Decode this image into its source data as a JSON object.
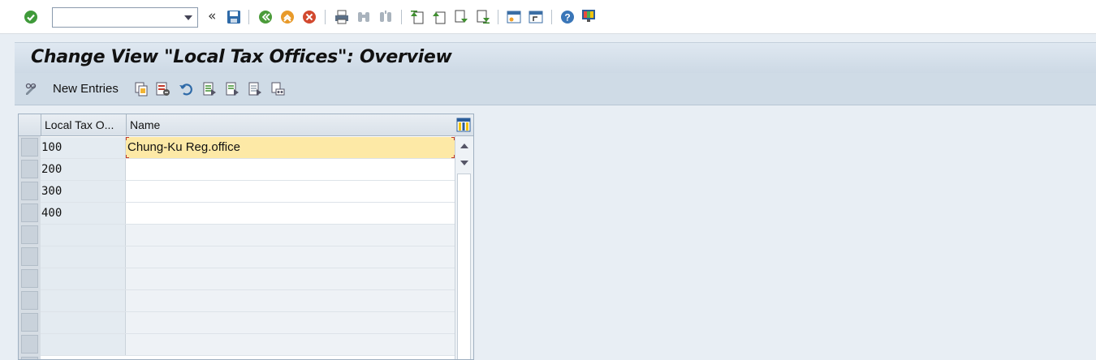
{
  "command_field": {
    "value": "",
    "placeholder": ""
  },
  "title": "Change View \"Local Tax Offices\": Overview",
  "app_toolbar": {
    "new_entries_label": "New Entries"
  },
  "table": {
    "columns": [
      "Local Tax O...",
      "Name"
    ],
    "rows": [
      {
        "code": "100",
        "name": "Chung-Ku Reg.office"
      },
      {
        "code": "200",
        "name": ""
      },
      {
        "code": "300",
        "name": ""
      },
      {
        "code": "400",
        "name": ""
      }
    ]
  },
  "colors": {
    "accent": "#fde9a6",
    "background": "#e8eef4",
    "title_bar": "#d6e0ea"
  },
  "icons": [
    "check-icon",
    "save-icon",
    "back-icon",
    "exit-icon",
    "cancel-icon",
    "print-icon",
    "find-icon",
    "find-next-icon",
    "first-page-icon",
    "previous-page-icon",
    "next-page-icon",
    "last-page-icon",
    "new-session-icon",
    "shortcut-icon",
    "help-icon",
    "customize-layout-icon"
  ]
}
